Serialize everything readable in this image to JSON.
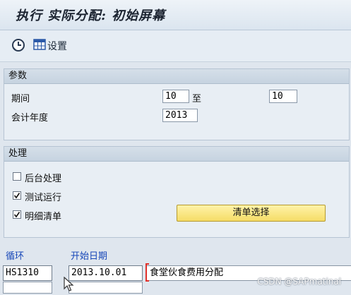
{
  "window": {
    "title": "执行 实际分配: 初始屏幕"
  },
  "toolbar": {
    "settings_label": "设置"
  },
  "params": {
    "group_title": "参数",
    "period_label": "期间",
    "period_from": "10",
    "to_label": "至",
    "period_to": "10",
    "fiscal_year_label": "会计年度",
    "fiscal_year": "2013"
  },
  "processing": {
    "group_title": "处理",
    "background_label": "后台处理",
    "background_checked": false,
    "test_run_label": "测试运行",
    "test_run_checked": true,
    "detail_list_label": "明细清单",
    "detail_list_checked": true,
    "list_selection_button": "清单选择"
  },
  "cycles": {
    "col_cycle": "循环",
    "col_start_date": "开始日期",
    "rows": [
      {
        "cycle": "HS1310",
        "start_date": "2013.10.01",
        "description": "食堂伙食费用分配"
      }
    ]
  },
  "watermark": "CSDN @SAPmatinal",
  "colors": {
    "accent_yellow": "#f5dc66",
    "header_blue": "#1747b8"
  }
}
